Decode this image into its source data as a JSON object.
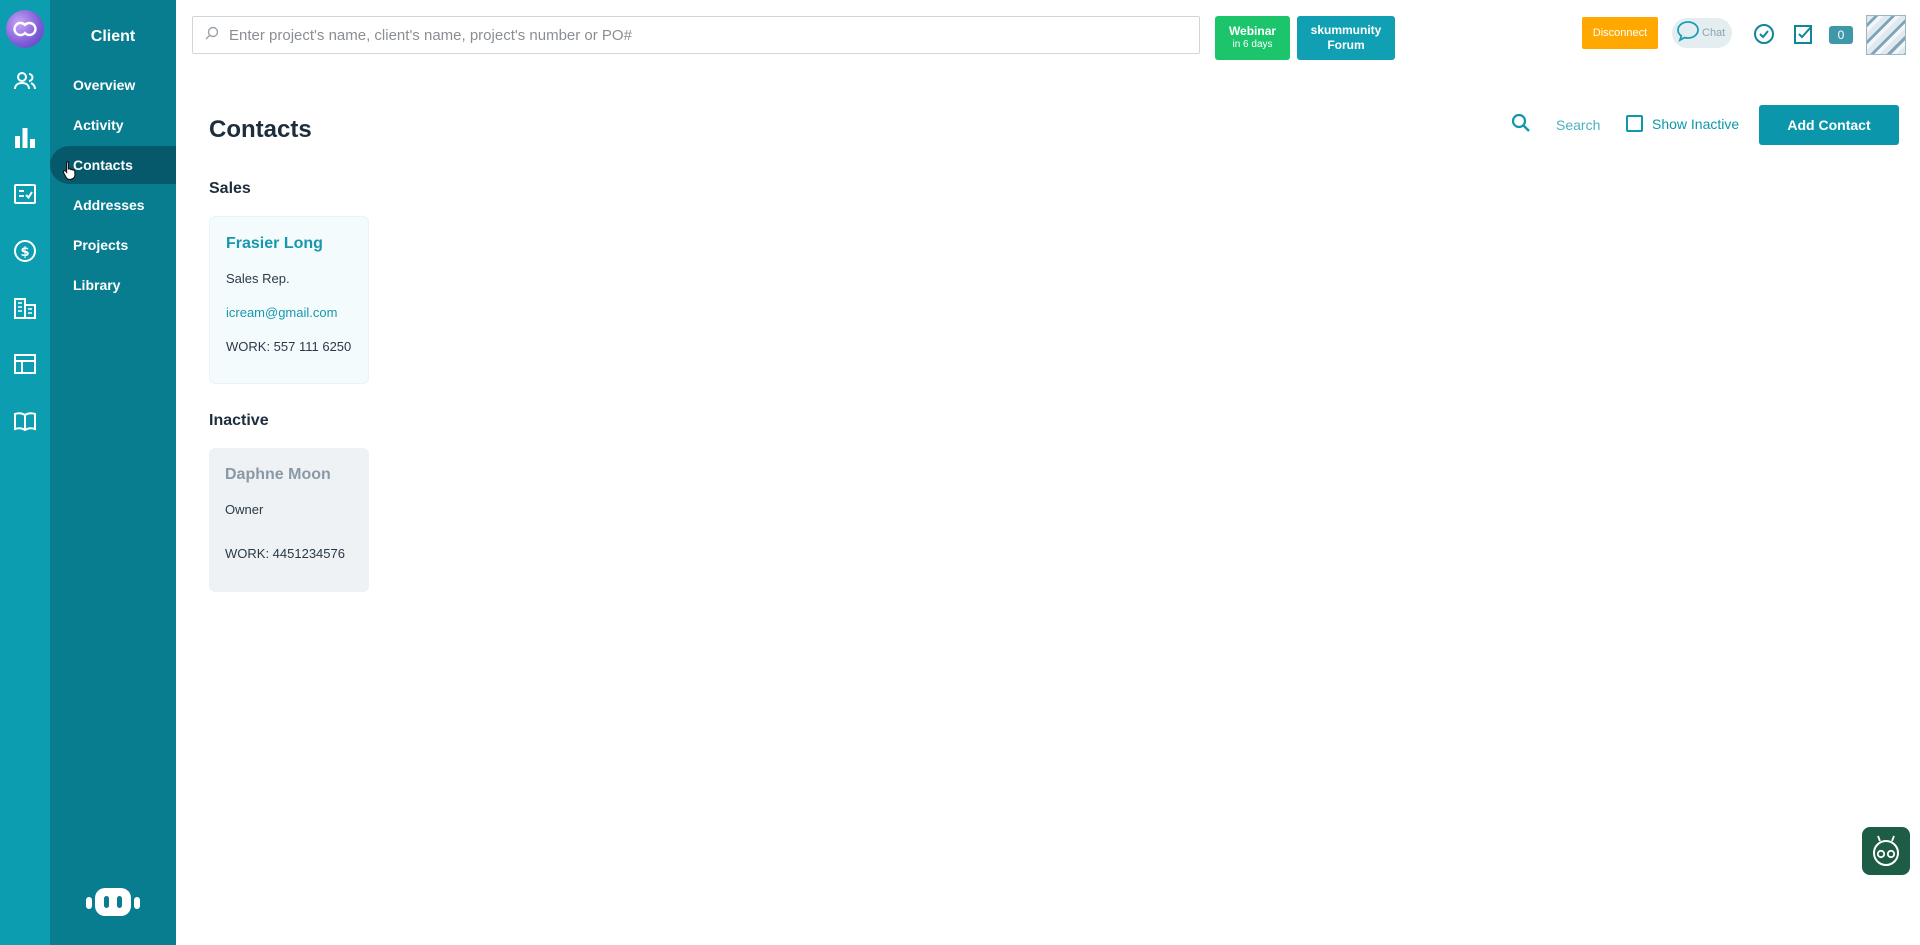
{
  "rail": {
    "icons": [
      "logo-icon",
      "users-icon",
      "chart-icon",
      "tasks-icon",
      "dollar-icon",
      "building-icon",
      "table-icon",
      "book-icon"
    ]
  },
  "subnav": {
    "title": "Client",
    "items": [
      {
        "label": "Overview"
      },
      {
        "label": "Activity"
      },
      {
        "label": "Contacts",
        "active": true
      },
      {
        "label": "Addresses"
      },
      {
        "label": "Projects"
      },
      {
        "label": "Library"
      }
    ]
  },
  "topbar": {
    "search_placeholder": "Enter project's name, client's name, project's number or PO#",
    "webinar_label": "Webinar",
    "webinar_sub": "in 6 days",
    "forum_line1": "skummunity",
    "forum_line2": "Forum",
    "disconnect_label": "Disconnect",
    "chat_label": "Chat",
    "notification_count": "0"
  },
  "main": {
    "title": "Contacts",
    "search_label": "Search",
    "show_inactive_label": "Show Inactive",
    "add_contact_label": "Add Contact",
    "sections": [
      {
        "heading": "Sales",
        "contacts": [
          {
            "name": "Frasier Long",
            "role": "Sales Rep.",
            "email": "icream@gmail.com",
            "phone": "WORK: 557 111 6250"
          }
        ]
      },
      {
        "heading": "Inactive",
        "contacts": [
          {
            "name": "Daphne Moon",
            "role": "Owner",
            "phone": "WORK: 4451234576"
          }
        ]
      }
    ]
  },
  "colors": {
    "rail": "#0c9db0",
    "subnav": "#087d8f",
    "subnav_active": "#06596a",
    "accent": "#0b96ab",
    "webinar": "#1cc46c",
    "disconnect": "#ffa800"
  }
}
